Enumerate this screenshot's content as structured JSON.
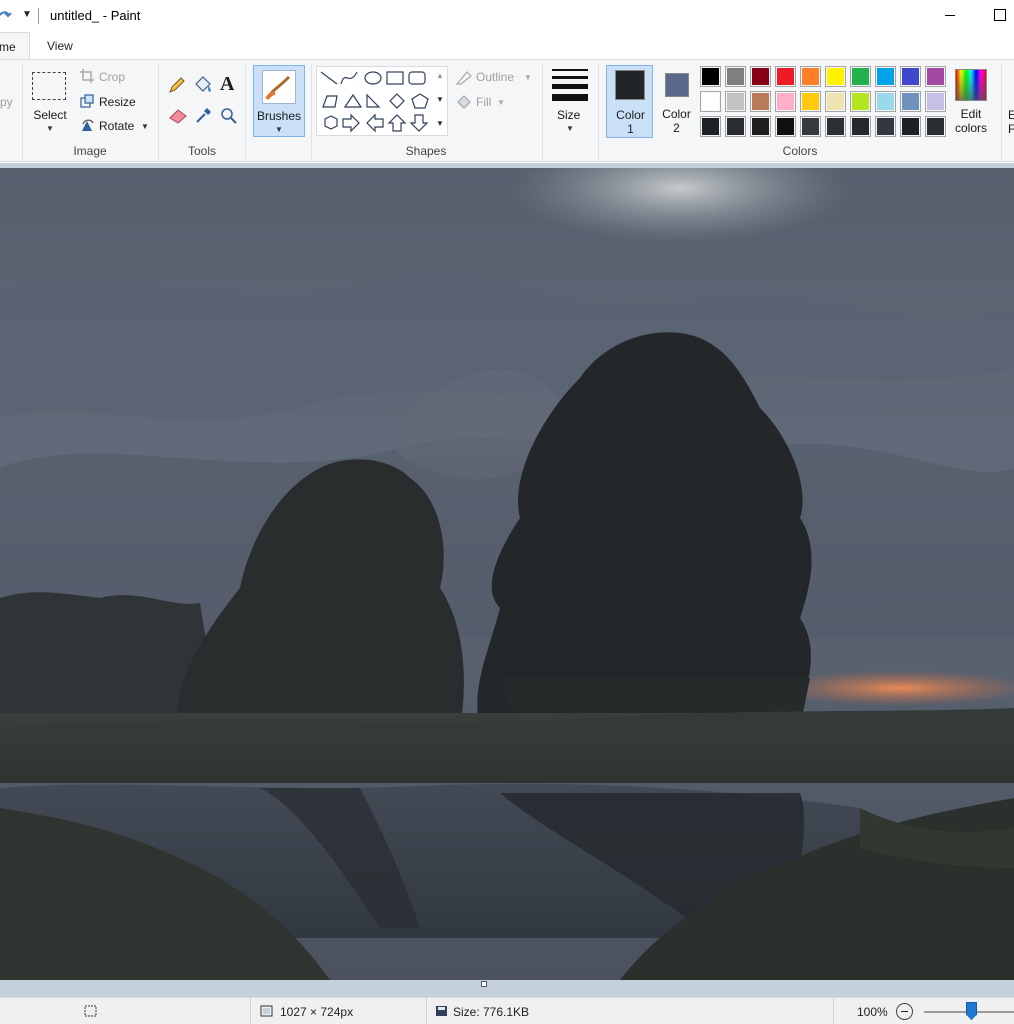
{
  "window": {
    "title": "untitled_ - Paint"
  },
  "tabs": [
    {
      "label": "me"
    },
    {
      "label": "View"
    }
  ],
  "ribbon": {
    "clipboard": {
      "copy_partial": "py"
    },
    "image": {
      "select_label": "Select",
      "crop_label": "Crop",
      "resize_label": "Resize",
      "rotate_label": "Rotate",
      "group_label": "Image"
    },
    "tools": {
      "group_label": "Tools",
      "text_glyph": "A"
    },
    "brushes": {
      "label": "Brushes"
    },
    "shapes": {
      "outline_label": "Outline",
      "fill_label": "Fill",
      "group_label": "Shapes"
    },
    "size": {
      "label": "Size"
    },
    "colors": {
      "color1_label_line1": "Color",
      "color1_label_line2": "1",
      "color2_label_line1": "Color",
      "color2_label_line2": "2",
      "color1_value": "#222527",
      "color2_value": "#5b6a8a",
      "group_label": "Colors",
      "edit_label_line1": "Edit",
      "edit_label_line2": "colors",
      "next_partial_line1": "E",
      "next_partial_line2": "F",
      "palette": [
        [
          "#000000",
          "#7f7f7f",
          "#880015",
          "#ed1c24",
          "#ff7f27",
          "#fff200",
          "#22b14c",
          "#00a2e8",
          "#3f48cc",
          "#a349a4"
        ],
        [
          "#ffffff",
          "#c3c3c3",
          "#b97a57",
          "#ffaec9",
          "#ffc90e",
          "#efe4b0",
          "#b5e61d",
          "#99d9ea",
          "#7092be",
          "#c8bfe7"
        ],
        [
          "#1f2224",
          "#2a2d2f",
          "#1c1e20",
          "#0f1012",
          "#353a3e",
          "#2c3033",
          "#25292c",
          "#323841",
          "#1e2123",
          "#2b2e31"
        ]
      ]
    }
  },
  "canvas": {
    "description_colors": {
      "sky": "#5e6876",
      "trees": "#25282a",
      "sunset": "#e07a48"
    }
  },
  "statusbar": {
    "dimensions": "1027 × 724px",
    "size": "Size: 776.1KB",
    "zoom": "100%"
  }
}
